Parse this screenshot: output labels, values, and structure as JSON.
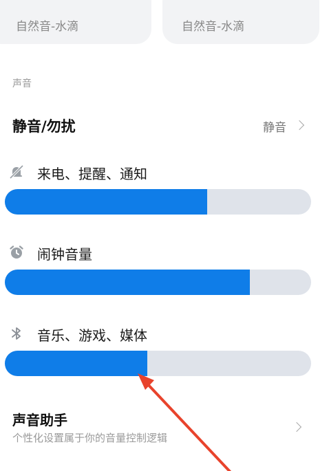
{
  "ringtone_cards": [
    {
      "subtitle": "自然音-水滴"
    },
    {
      "subtitle": "自然音-水滴"
    }
  ],
  "section_label": "声音",
  "dnd": {
    "title": "静音/勿扰",
    "value": "静音"
  },
  "volumes": [
    {
      "label": "来电、提醒、通知",
      "icon": "bell-mute-icon",
      "level": 0.66
    },
    {
      "label": "闹钟音量",
      "icon": "alarm-clock-icon",
      "level": 0.8
    },
    {
      "label": "音乐、游戏、媒体",
      "icon": "bluetooth-icon",
      "level": 0.465
    }
  ],
  "sound_assistant": {
    "title": "声音助手",
    "subtitle": "个性化设置属于你的音量控制逻辑"
  },
  "colors": {
    "accent": "#0f7de8",
    "track": "#dfe3ea",
    "annotation_arrow": "#e8432c"
  }
}
